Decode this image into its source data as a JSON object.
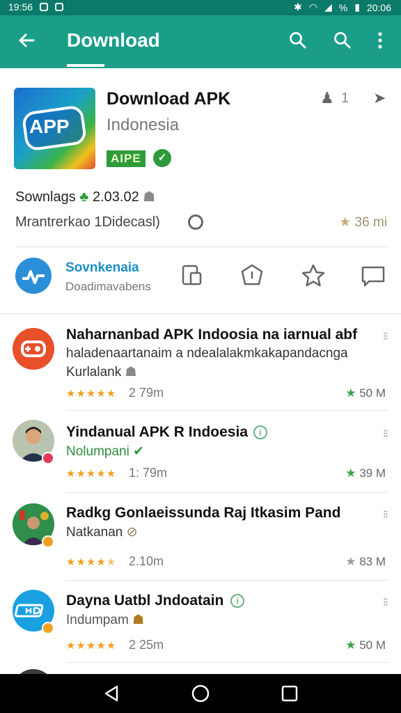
{
  "status_bar": {
    "time_left": "19:56",
    "time_right": "20:06",
    "battery": "%"
  },
  "app_bar": {
    "title": "Download"
  },
  "hero": {
    "logo_text": "APP",
    "name": "Download APK",
    "subtitle": "Indonesia",
    "tag": "AIPE",
    "person_count": "1",
    "stats_label": "Sownlags",
    "stats_value": "2.03.02",
    "meta_text": "Mrantrerkao  1Didecasl)",
    "rating": "36 mi"
  },
  "action_row": {
    "title": "Sovnkenaia",
    "subtitle": "Doadimavabens"
  },
  "list": [
    {
      "title": "Naharnanbad APK Indoosia na iarnual abf",
      "line2": "haladenaartanaim a ndealalakmkakapandacnga",
      "line3": "Kurlalank",
      "meta": "2 79m",
      "right": "50 M",
      "rating": 4.5
    },
    {
      "title": "Yindanual APK R Indoesia",
      "line2": "Nolumpani",
      "meta": "1: 79m",
      "right": "39 M",
      "rating": 4.5
    },
    {
      "title": "Radkg Gonlaeissunda Raj Itkasim Pand",
      "line2": "Natkanan",
      "meta": "2.10m",
      "right": "83 M",
      "rating": 4
    },
    {
      "title": "Dayna Uatbl Jndoatain",
      "line2": "Indumpam",
      "meta": "2 25m",
      "right": "50 M",
      "rating": 4.5
    }
  ],
  "colors": {
    "primary": "#1a9e8a",
    "status": "#0b7a6a",
    "green": "#2e9b3a",
    "star": "#f0a020"
  }
}
